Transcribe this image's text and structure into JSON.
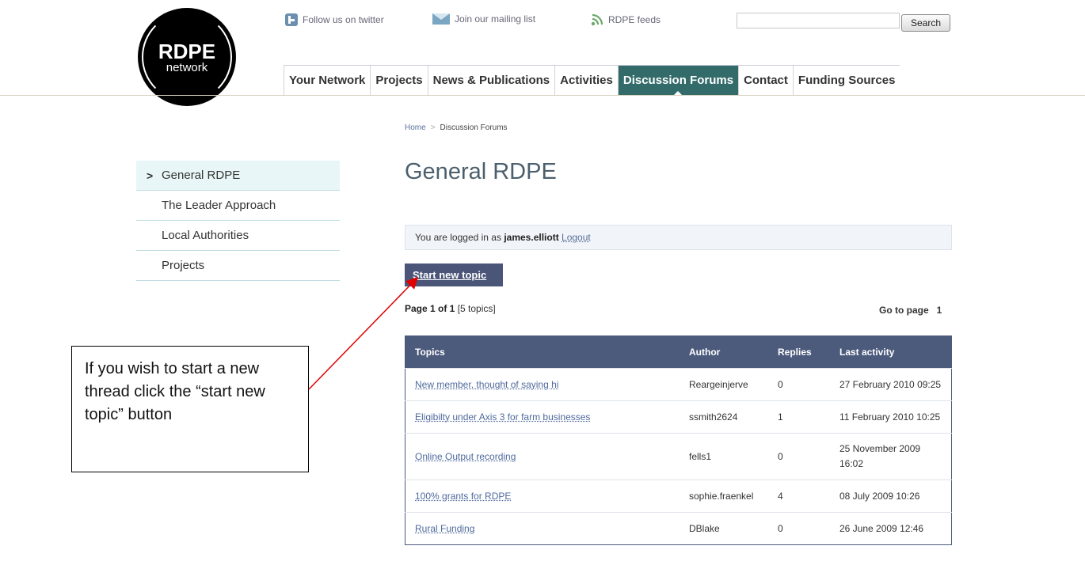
{
  "header": {
    "logo": {
      "main": "RDPE",
      "sub": "network"
    },
    "links": [
      {
        "label": "Follow us on twitter",
        "icon": "twitter-icon"
      },
      {
        "label": "Join our mailing list",
        "icon": "mail-icon"
      },
      {
        "label": "RDPE feeds",
        "icon": "rss-icon"
      }
    ],
    "search": {
      "value": "",
      "button": "Search"
    },
    "nav": [
      {
        "label": "Your Network",
        "active": false
      },
      {
        "label": "Projects",
        "active": false
      },
      {
        "label": "News & Publications",
        "active": false
      },
      {
        "label": "Activities",
        "active": false
      },
      {
        "label": "Discussion Forums",
        "active": true
      },
      {
        "label": "Contact",
        "active": false
      },
      {
        "label": "Funding Sources",
        "active": false
      }
    ]
  },
  "breadcrumb": {
    "home": "Home",
    "current": "Discussion Forums"
  },
  "sidebar": {
    "items": [
      {
        "label": "General RDPE",
        "active": true
      },
      {
        "label": "The Leader Approach",
        "active": false
      },
      {
        "label": "Local Authorities",
        "active": false
      },
      {
        "label": "Projects",
        "active": false
      }
    ]
  },
  "main": {
    "title": "General RDPE",
    "login": {
      "prefix": "You are logged in as",
      "user": "james.elliott",
      "logout": "Logout"
    },
    "start_topic": "Start new topic",
    "page_info": {
      "page": "Page 1 of 1",
      "count": "[5 topics]"
    },
    "goto": {
      "label": "Go to page",
      "page": "1"
    },
    "table": {
      "headers": {
        "topics": "Topics",
        "author": "Author",
        "replies": "Replies",
        "last": "Last activity"
      },
      "rows": [
        {
          "topic": "New member, thought of saying hi",
          "author": "Reargeinjerve",
          "replies": "0",
          "last": "27 February 2010 09:25"
        },
        {
          "topic": "Eligibilty under Axis 3 for farm businesses",
          "author": "ssmith2624",
          "replies": "1",
          "last": "11 February 2010 10:25"
        },
        {
          "topic": "Online Output recording",
          "author": "fells1",
          "replies": "0",
          "last": "25 November 2009 16:02"
        },
        {
          "topic": "100% grants for RDPE",
          "author": "sophie.fraenkel",
          "replies": "4",
          "last": "08 July 2009 10:26"
        },
        {
          "topic": "Rural Funding",
          "author": "DBlake",
          "replies": "0",
          "last": "26 June 2009 12:46"
        }
      ]
    }
  },
  "annotation": {
    "text": "If you wish to start a new thread click the “start new topic” button",
    "arrow_color": "#e00000"
  },
  "colors": {
    "nav_active": "#336b6b",
    "table_header": "#4c5a7c",
    "link": "#4f6a9c"
  }
}
